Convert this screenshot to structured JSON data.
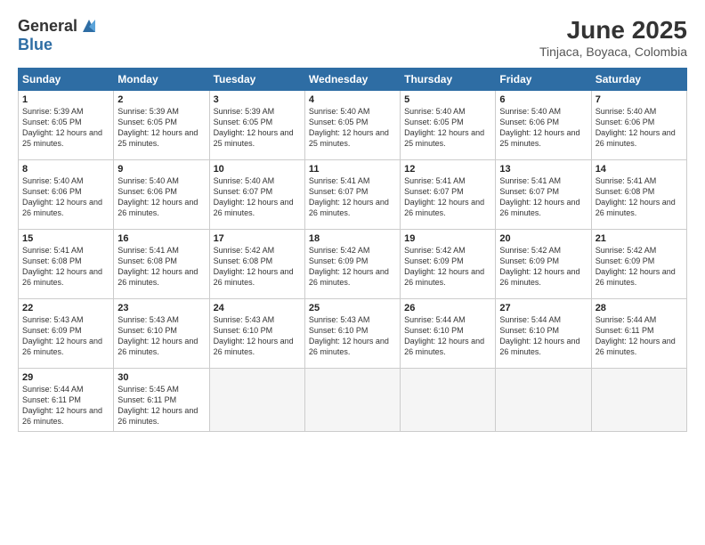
{
  "logo": {
    "general": "General",
    "blue": "Blue"
  },
  "title": {
    "month_year": "June 2025",
    "location": "Tinjaca, Boyaca, Colombia"
  },
  "weekdays": [
    "Sunday",
    "Monday",
    "Tuesday",
    "Wednesday",
    "Thursday",
    "Friday",
    "Saturday"
  ],
  "weeks": [
    [
      {
        "day": "1",
        "sunrise": "Sunrise: 5:39 AM",
        "sunset": "Sunset: 6:05 PM",
        "daylight": "Daylight: 12 hours and 25 minutes."
      },
      {
        "day": "2",
        "sunrise": "Sunrise: 5:39 AM",
        "sunset": "Sunset: 6:05 PM",
        "daylight": "Daylight: 12 hours and 25 minutes."
      },
      {
        "day": "3",
        "sunrise": "Sunrise: 5:39 AM",
        "sunset": "Sunset: 6:05 PM",
        "daylight": "Daylight: 12 hours and 25 minutes."
      },
      {
        "day": "4",
        "sunrise": "Sunrise: 5:40 AM",
        "sunset": "Sunset: 6:05 PM",
        "daylight": "Daylight: 12 hours and 25 minutes."
      },
      {
        "day": "5",
        "sunrise": "Sunrise: 5:40 AM",
        "sunset": "Sunset: 6:05 PM",
        "daylight": "Daylight: 12 hours and 25 minutes."
      },
      {
        "day": "6",
        "sunrise": "Sunrise: 5:40 AM",
        "sunset": "Sunset: 6:06 PM",
        "daylight": "Daylight: 12 hours and 25 minutes."
      },
      {
        "day": "7",
        "sunrise": "Sunrise: 5:40 AM",
        "sunset": "Sunset: 6:06 PM",
        "daylight": "Daylight: 12 hours and 26 minutes."
      }
    ],
    [
      {
        "day": "8",
        "sunrise": "Sunrise: 5:40 AM",
        "sunset": "Sunset: 6:06 PM",
        "daylight": "Daylight: 12 hours and 26 minutes."
      },
      {
        "day": "9",
        "sunrise": "Sunrise: 5:40 AM",
        "sunset": "Sunset: 6:06 PM",
        "daylight": "Daylight: 12 hours and 26 minutes."
      },
      {
        "day": "10",
        "sunrise": "Sunrise: 5:40 AM",
        "sunset": "Sunset: 6:07 PM",
        "daylight": "Daylight: 12 hours and 26 minutes."
      },
      {
        "day": "11",
        "sunrise": "Sunrise: 5:41 AM",
        "sunset": "Sunset: 6:07 PM",
        "daylight": "Daylight: 12 hours and 26 minutes."
      },
      {
        "day": "12",
        "sunrise": "Sunrise: 5:41 AM",
        "sunset": "Sunset: 6:07 PM",
        "daylight": "Daylight: 12 hours and 26 minutes."
      },
      {
        "day": "13",
        "sunrise": "Sunrise: 5:41 AM",
        "sunset": "Sunset: 6:07 PM",
        "daylight": "Daylight: 12 hours and 26 minutes."
      },
      {
        "day": "14",
        "sunrise": "Sunrise: 5:41 AM",
        "sunset": "Sunset: 6:08 PM",
        "daylight": "Daylight: 12 hours and 26 minutes."
      }
    ],
    [
      {
        "day": "15",
        "sunrise": "Sunrise: 5:41 AM",
        "sunset": "Sunset: 6:08 PM",
        "daylight": "Daylight: 12 hours and 26 minutes."
      },
      {
        "day": "16",
        "sunrise": "Sunrise: 5:41 AM",
        "sunset": "Sunset: 6:08 PM",
        "daylight": "Daylight: 12 hours and 26 minutes."
      },
      {
        "day": "17",
        "sunrise": "Sunrise: 5:42 AM",
        "sunset": "Sunset: 6:08 PM",
        "daylight": "Daylight: 12 hours and 26 minutes."
      },
      {
        "day": "18",
        "sunrise": "Sunrise: 5:42 AM",
        "sunset": "Sunset: 6:09 PM",
        "daylight": "Daylight: 12 hours and 26 minutes."
      },
      {
        "day": "19",
        "sunrise": "Sunrise: 5:42 AM",
        "sunset": "Sunset: 6:09 PM",
        "daylight": "Daylight: 12 hours and 26 minutes."
      },
      {
        "day": "20",
        "sunrise": "Sunrise: 5:42 AM",
        "sunset": "Sunset: 6:09 PM",
        "daylight": "Daylight: 12 hours and 26 minutes."
      },
      {
        "day": "21",
        "sunrise": "Sunrise: 5:42 AM",
        "sunset": "Sunset: 6:09 PM",
        "daylight": "Daylight: 12 hours and 26 minutes."
      }
    ],
    [
      {
        "day": "22",
        "sunrise": "Sunrise: 5:43 AM",
        "sunset": "Sunset: 6:09 PM",
        "daylight": "Daylight: 12 hours and 26 minutes."
      },
      {
        "day": "23",
        "sunrise": "Sunrise: 5:43 AM",
        "sunset": "Sunset: 6:10 PM",
        "daylight": "Daylight: 12 hours and 26 minutes."
      },
      {
        "day": "24",
        "sunrise": "Sunrise: 5:43 AM",
        "sunset": "Sunset: 6:10 PM",
        "daylight": "Daylight: 12 hours and 26 minutes."
      },
      {
        "day": "25",
        "sunrise": "Sunrise: 5:43 AM",
        "sunset": "Sunset: 6:10 PM",
        "daylight": "Daylight: 12 hours and 26 minutes."
      },
      {
        "day": "26",
        "sunrise": "Sunrise: 5:44 AM",
        "sunset": "Sunset: 6:10 PM",
        "daylight": "Daylight: 12 hours and 26 minutes."
      },
      {
        "day": "27",
        "sunrise": "Sunrise: 5:44 AM",
        "sunset": "Sunset: 6:10 PM",
        "daylight": "Daylight: 12 hours and 26 minutes."
      },
      {
        "day": "28",
        "sunrise": "Sunrise: 5:44 AM",
        "sunset": "Sunset: 6:11 PM",
        "daylight": "Daylight: 12 hours and 26 minutes."
      }
    ],
    [
      {
        "day": "29",
        "sunrise": "Sunrise: 5:44 AM",
        "sunset": "Sunset: 6:11 PM",
        "daylight": "Daylight: 12 hours and 26 minutes."
      },
      {
        "day": "30",
        "sunrise": "Sunrise: 5:45 AM",
        "sunset": "Sunset: 6:11 PM",
        "daylight": "Daylight: 12 hours and 26 minutes."
      },
      {
        "day": "",
        "sunrise": "",
        "sunset": "",
        "daylight": ""
      },
      {
        "day": "",
        "sunrise": "",
        "sunset": "",
        "daylight": ""
      },
      {
        "day": "",
        "sunrise": "",
        "sunset": "",
        "daylight": ""
      },
      {
        "day": "",
        "sunrise": "",
        "sunset": "",
        "daylight": ""
      },
      {
        "day": "",
        "sunrise": "",
        "sunset": "",
        "daylight": ""
      }
    ]
  ]
}
